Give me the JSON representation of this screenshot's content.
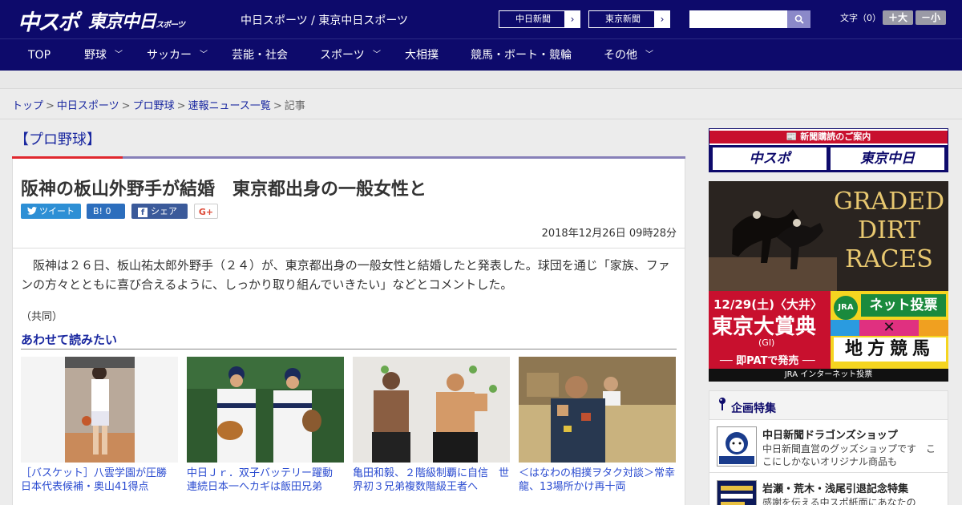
{
  "header": {
    "logo_main": "中スポ",
    "logo_tokyo": "東京中日",
    "logo_tokyo_sub": "スポーツ",
    "site_name": "中日スポーツ / 東京中日スポーツ",
    "links": [
      {
        "label": "中日新聞"
      },
      {
        "label": "東京新聞"
      }
    ],
    "search_placeholder": "",
    "font_size_label": "文字（0）",
    "font_larger": "＋大",
    "font_smaller": "－小"
  },
  "nav": {
    "items": [
      {
        "label": "TOP",
        "dropdown": false
      },
      {
        "label": "野球",
        "dropdown": true
      },
      {
        "label": "サッカー",
        "dropdown": true
      },
      {
        "label": "芸能・社会",
        "dropdown": false
      },
      {
        "label": "スポーツ",
        "dropdown": true
      },
      {
        "label": "大相撲",
        "dropdown": false
      },
      {
        "label": "競馬・ボート・競輪",
        "dropdown": false
      },
      {
        "label": "その他",
        "dropdown": true
      }
    ]
  },
  "breadcrumb": {
    "items": [
      "トップ",
      "中日スポーツ",
      "プロ野球",
      "速報ニュース一覧"
    ],
    "current": "記事",
    "separator": ">"
  },
  "article": {
    "category": "【プロ野球】",
    "headline": "阪神の板山外野手が結婚　東京都出身の一般女性と",
    "share": {
      "tweet": "ツイート",
      "hatena": "B! 0",
      "facebook": "シェア 0",
      "gplus": "G+"
    },
    "date": "2018年12月26日 09時28分",
    "body": "　阪神は２６日、板山祐太郎外野手（２４）が、東京都出身の一般女性と結婚したと発表した。球団を通じ「家族、ファンの方々とともに喜び合えるように、しっかり取り組んでいきたい」などとコメントした。",
    "credit": "（共同）",
    "related_title": "あわせて読みたい",
    "related": [
      {
        "caption": "［バスケット］八雲学園が圧勝　日本代表候補・奥山41得点"
      },
      {
        "caption": "中日Ｊｒ．双子バッテリー躍動　連続日本一へカギは飯田兄弟"
      },
      {
        "caption": "亀田和毅、２階級制覇に自信　世界初３兄弟複数階級王者へ"
      },
      {
        "caption": "＜はなわの相撲ヲタク対談＞常幸龍、13場所かけ再十両"
      }
    ]
  },
  "sidebar": {
    "subscribe_title": "新聞購読のご案内",
    "subscribe_buttons": [
      "中スポ",
      "東京中日"
    ],
    "ad": {
      "title": "GRADED DIRT RACES",
      "date": "12/29(土)〈大井〉",
      "race": "東京大賞典",
      "grade": "(GI)",
      "pat": "── 即PATで発売 ──",
      "jra": "JRA",
      "net": "ネット投票",
      "chiho": "地方競馬",
      "footer": "JRA インターネット投票"
    },
    "feature_title": "企画特集",
    "features": [
      {
        "title": "中日新聞ドラゴンズショップ",
        "desc": "中日新聞直営のグッズショップです　ここにしかないオリジナル商品も"
      },
      {
        "title": "岩瀬・荒木・浅尾引退記念特集",
        "desc": "感謝を伝える中スポ紙面にあなたの"
      }
    ]
  },
  "colors": {
    "brand_navy": "#0d0a6b",
    "accent_red": "#e0282e",
    "link_blue": "#1a28a0"
  }
}
